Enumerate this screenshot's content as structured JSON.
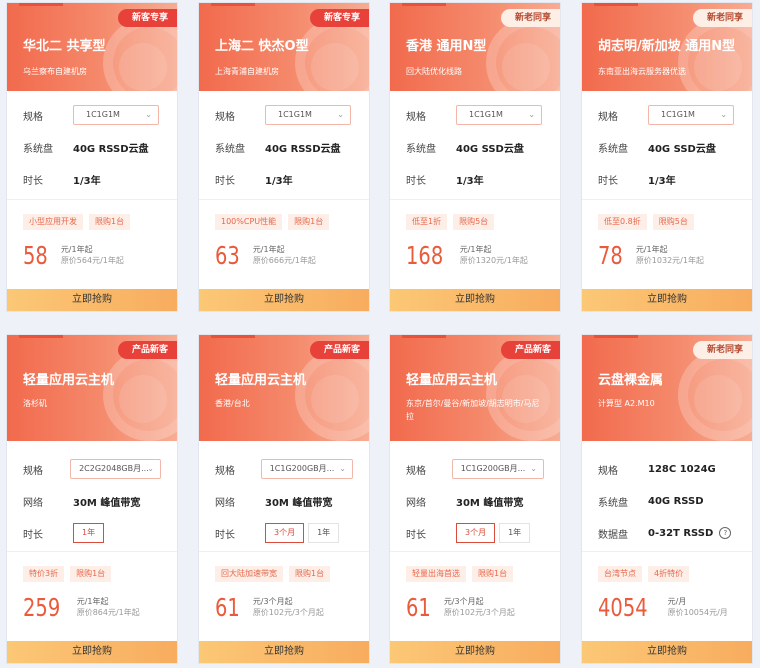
{
  "cards": [
    {
      "badge": "新客专享",
      "title": "华北二 共享型",
      "subtitle": "乌兰察布自建机房",
      "specs": {
        "spec_label": "规格",
        "spec_value": "1C1G1M",
        "disk_label": "系统盘",
        "disk_value": "40G RSSD云盘",
        "duration_label": "时长",
        "duration_value": "1/3年"
      },
      "tags": [
        "小型应用开发",
        "限购1台"
      ],
      "price": "58",
      "price_unit": "元/1年起",
      "original": "原价564元/1年起",
      "buy": "立即抢购"
    },
    {
      "badge": "新客专享",
      "title": "上海二 快杰O型",
      "subtitle": "上海青浦自建机房",
      "specs": {
        "spec_label": "规格",
        "spec_value": "1C1G1M",
        "disk_label": "系统盘",
        "disk_value": "40G RSSD云盘",
        "duration_label": "时长",
        "duration_value": "1/3年"
      },
      "tags": [
        "100%CPU性能",
        "限购1台"
      ],
      "price": "63",
      "price_unit": "元/1年起",
      "original": "原价666元/1年起",
      "buy": "立即抢购"
    },
    {
      "badge": "新老同享",
      "title": "香港 通用N型",
      "subtitle": "回大陆优化线路",
      "specs": {
        "spec_label": "规格",
        "spec_value": "1C1G1M",
        "disk_label": "系统盘",
        "disk_value": "40G SSD云盘",
        "duration_label": "时长",
        "duration_value": "1/3年"
      },
      "tags": [
        "低至1折",
        "限购5台"
      ],
      "price": "168",
      "price_unit": "元/1年起",
      "original": "原价1320元/1年起",
      "buy": "立即抢购"
    },
    {
      "badge": "新老同享",
      "title": "胡志明/新加坡 通用N型",
      "subtitle": "东南亚出海云服务器优选",
      "specs": {
        "spec_label": "规格",
        "spec_value": "1C1G1M",
        "disk_label": "系统盘",
        "disk_value": "40G SSD云盘",
        "duration_label": "时长",
        "duration_value": "1/3年"
      },
      "tags": [
        "低至0.8折",
        "限购5台"
      ],
      "price": "78",
      "price_unit": "元/1年起",
      "original": "原价1032元/1年起",
      "buy": "立即抢购"
    },
    {
      "badge": "产品新客",
      "title": "轻量应用云主机",
      "subtitle": "洛杉矶",
      "specs": {
        "spec_label": "规格",
        "spec_value": "2C2G2048GB月...",
        "net_label": "网络",
        "net_value": "30M 峰值带宽",
        "duration_label": "时长",
        "durations": [
          "1年"
        ]
      },
      "tags": [
        "特价3折",
        "限购1台"
      ],
      "price": "259",
      "price_unit": "元/1年起",
      "original": "原价864元/1年起",
      "buy": "立即抢购"
    },
    {
      "badge": "产品新客",
      "title": "轻量应用云主机",
      "subtitle": "香港/台北",
      "specs": {
        "spec_label": "规格",
        "spec_value": "1C1G200GB月...",
        "net_label": "网络",
        "net_value": "30M 峰值带宽",
        "duration_label": "时长",
        "durations": [
          "3个月",
          "1年"
        ]
      },
      "tags": [
        "回大陆加速带宽",
        "限购1台"
      ],
      "price": "61",
      "price_unit": "元/3个月起",
      "original": "原价102元/3个月起",
      "buy": "立即抢购"
    },
    {
      "badge": "产品新客",
      "title": "轻量应用云主机",
      "subtitle": "东京/首尔/曼谷/新加坡/胡志明市/马尼拉",
      "specs": {
        "spec_label": "规格",
        "spec_value": "1C1G200GB月...",
        "net_label": "网络",
        "net_value": "30M 峰值带宽",
        "duration_label": "时长",
        "durations": [
          "3个月",
          "1年"
        ]
      },
      "tags": [
        "轻量出海首选",
        "限购1台"
      ],
      "price": "61",
      "price_unit": "元/3个月起",
      "original": "原价102元/3个月起",
      "buy": "立即抢购"
    },
    {
      "badge": "新老同享",
      "title": "云盘裸金属",
      "subtitle": "计算型 A2.M10",
      "specs": {
        "spec_label": "规格",
        "spec_value": "128C 1024G",
        "disk_label": "系统盘",
        "disk_value": "40G RSSD",
        "data_label": "数据盘",
        "data_value": "0-32T RSSD"
      },
      "tags": [
        "台湾节点",
        "4折特价"
      ],
      "price": "4054",
      "price_unit": "元/月",
      "original": "原价10054元/月",
      "buy": "立即抢购"
    }
  ],
  "colors": {
    "accent": "#ea5b3c",
    "badge_red": "#e8413a",
    "header_gradient_start": "#f26a4d",
    "buy_gradient": "#f8ac5e"
  }
}
